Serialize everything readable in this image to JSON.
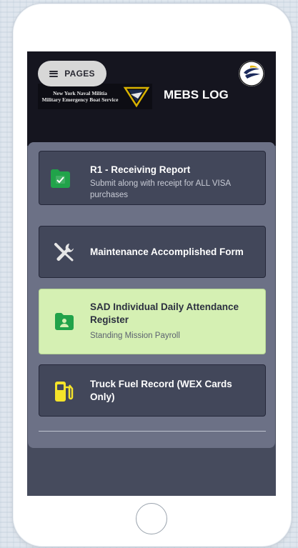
{
  "header": {
    "pages_label": "PAGES",
    "app_title": "MEBS LOG",
    "logo_line1": "New York Naval Militia",
    "logo_line2": "Military Emergency Boat Service"
  },
  "menu": {
    "items": [
      {
        "title": "R1 - Receiving Report",
        "subtitle": "Submit along with receipt for ALL VISA purchases",
        "icon": "folder-check-icon"
      },
      {
        "title": "Maintenance Accomplished Form",
        "subtitle": "",
        "icon": "tools-icon"
      },
      {
        "title": "SAD Individual Daily Attendance Register",
        "subtitle": "Standing Mission Payroll",
        "icon": "folder-person-icon",
        "selected": true
      },
      {
        "title": "Truck Fuel Record (WEX Cards Only)",
        "subtitle": "",
        "icon": "gas-pump-icon"
      }
    ]
  },
  "colors": {
    "topbar": "#15151f",
    "screen_bg": "#464b5d",
    "panel_bg": "#6c7186",
    "card_bg": "#42475a",
    "selected_card": "#d5f0b3",
    "accent_green": "#21a34a",
    "fuel_yellow": "#f5e42a"
  }
}
